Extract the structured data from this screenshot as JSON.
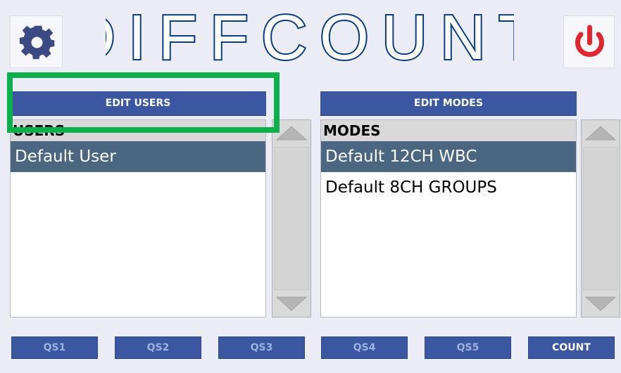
{
  "app": {
    "title": "DIFFCOUNT",
    "colors": {
      "accent": "#3b57a2",
      "title_stroke": "#0a3d82",
      "power": "#e0262e",
      "gear": "#3b4a82",
      "selection": "#4b6680",
      "highlight": "#0bb04a"
    },
    "icons": {
      "settings": "gear-icon",
      "power": "power-icon"
    }
  },
  "users_panel": {
    "edit_label": "EDIT USERS",
    "header": "USERS",
    "items": [
      {
        "label": "Default User",
        "selected": true
      }
    ]
  },
  "modes_panel": {
    "edit_label": "EDIT MODES",
    "header": "MODES",
    "items": [
      {
        "label": "Default 12CH WBC",
        "selected": true
      },
      {
        "label": "Default 8CH GROUPS",
        "selected": false
      }
    ]
  },
  "footer": {
    "buttons": [
      {
        "label": "QS1",
        "enabled": false
      },
      {
        "label": "QS2",
        "enabled": false
      },
      {
        "label": "QS3",
        "enabled": false
      },
      {
        "label": "QS4",
        "enabled": false
      },
      {
        "label": "QS5",
        "enabled": false
      },
      {
        "label": "COUNT",
        "enabled": true
      }
    ]
  }
}
